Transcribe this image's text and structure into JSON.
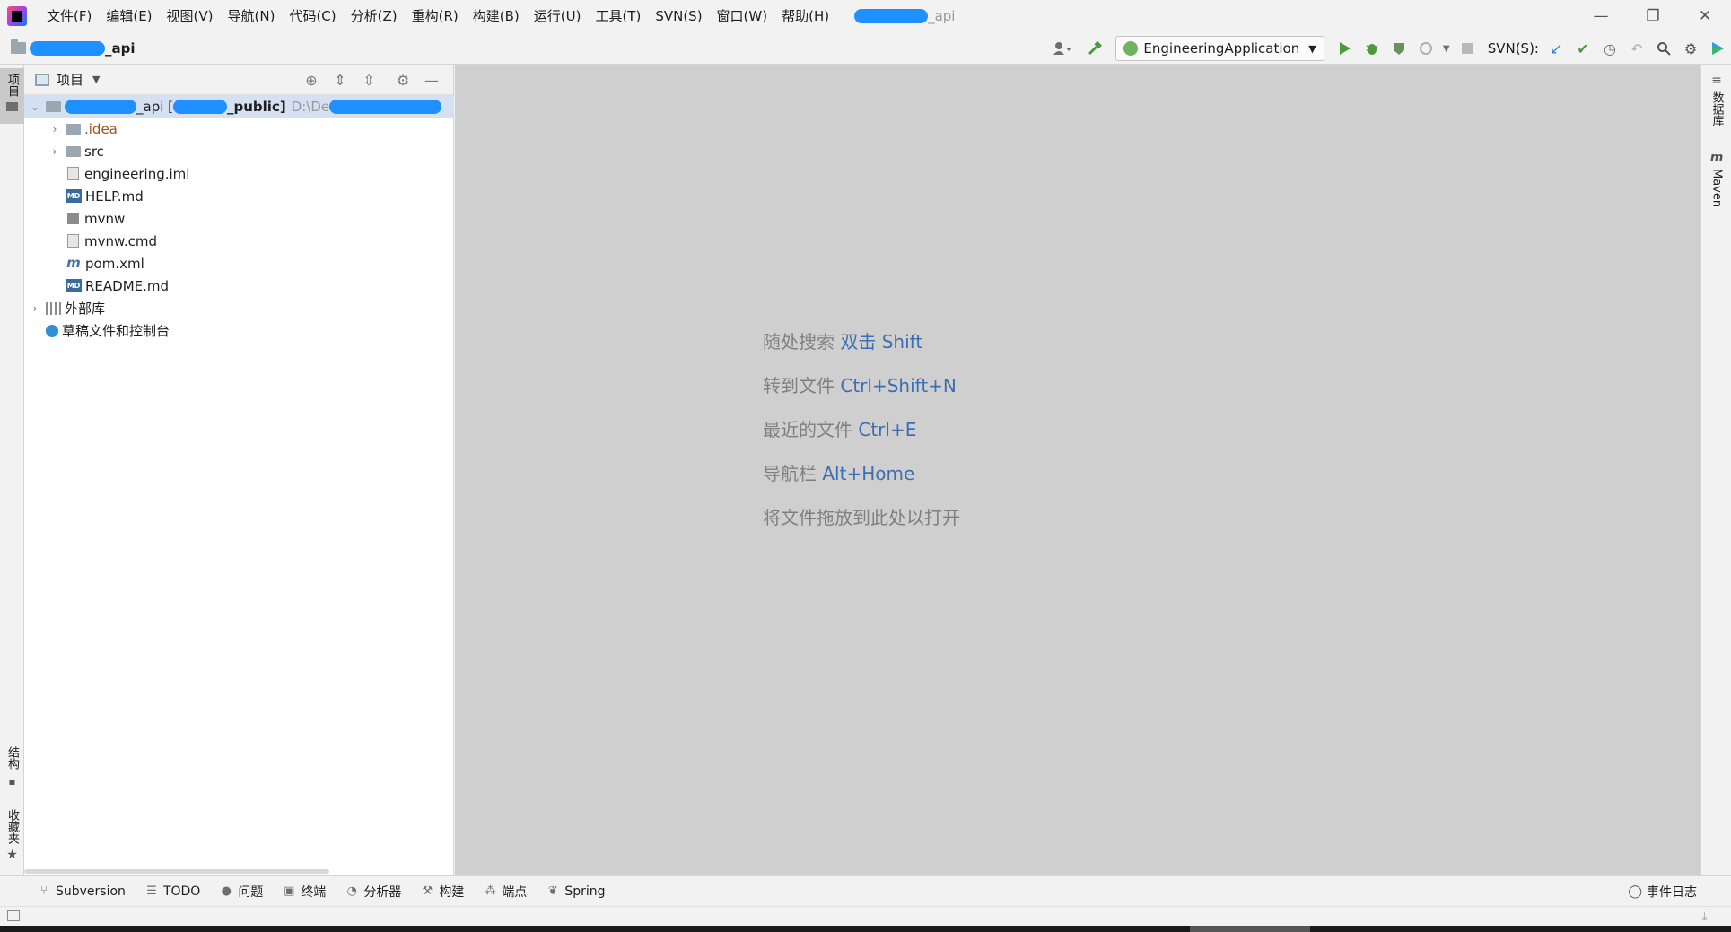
{
  "menu": [
    "文件(F)",
    "编辑(E)",
    "视图(V)",
    "导航(N)",
    "代码(C)",
    "分析(Z)",
    "重构(R)",
    "构建(B)",
    "运行(U)",
    "工具(T)",
    "SVN(S)",
    "窗口(W)",
    "帮助(H)"
  ],
  "title": {
    "suffix": "_api"
  },
  "window_controls": {
    "minimize": "—",
    "restore": "❐",
    "close": "✕"
  },
  "navbar": {
    "project_suffix": "_api",
    "run_config": "EngineeringApplication",
    "svn_label": "SVN(S):"
  },
  "left_strip": {
    "project_tab": "项目",
    "structure_tab": "结构",
    "favorites_tab": "收藏夹"
  },
  "right_strip": {
    "database_tab": "数据库",
    "maven_tab": "Maven"
  },
  "project_panel": {
    "title": "项目",
    "root": {
      "name_mid": "_api [",
      "name_end": "_public]",
      "path": "D:\\De"
    },
    "items": [
      {
        "label": ".idea"
      },
      {
        "label": "src"
      },
      {
        "label": "engineering.iml"
      },
      {
        "label": "HELP.md"
      },
      {
        "label": "mvnw"
      },
      {
        "label": "mvnw.cmd"
      },
      {
        "label": "pom.xml"
      },
      {
        "label": "README.md"
      },
      {
        "label": "外部库"
      },
      {
        "label": "草稿文件和控制台"
      }
    ]
  },
  "editor_hints": [
    {
      "text": "随处搜索 ",
      "key": "双击 Shift"
    },
    {
      "text": "转到文件 ",
      "key": "Ctrl+Shift+N"
    },
    {
      "text": "最近的文件 ",
      "key": "Ctrl+E"
    },
    {
      "text": "导航栏 ",
      "key": "Alt+Home"
    },
    {
      "text": "将文件拖放到此处以打开",
      "key": ""
    }
  ],
  "bottom_tabs": [
    "Subversion",
    "TODO",
    "问题",
    "终端",
    "分析器",
    "构建",
    "端点",
    "Spring"
  ],
  "event_log": "事件日志"
}
